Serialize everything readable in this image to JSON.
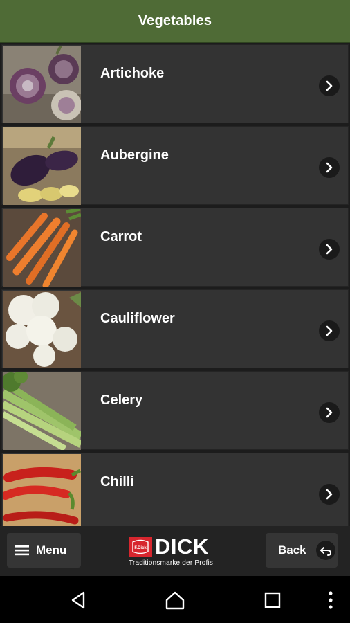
{
  "header": {
    "title": "Vegetables"
  },
  "items": [
    {
      "label": "Artichoke",
      "icon": "artichoke-image"
    },
    {
      "label": "Aubergine",
      "icon": "aubergine-image"
    },
    {
      "label": "Carrot",
      "icon": "carrot-image"
    },
    {
      "label": "Cauliflower",
      "icon": "cauliflower-image"
    },
    {
      "label": "Celery",
      "icon": "celery-image"
    },
    {
      "label": "Chilli",
      "icon": "chilli-image"
    }
  ],
  "footer": {
    "menu_label": "Menu",
    "back_label": "Back",
    "logo_word": "DICK",
    "logo_tagline": "Traditionsmarke der Profis",
    "logo_box_text": "F.Dick"
  },
  "colors": {
    "header_bg": "#4f6b36",
    "row_bg": "#333333",
    "brand_red": "#d7262e"
  },
  "system_nav": [
    "back-triangle-icon",
    "home-icon",
    "recents-square-icon",
    "overflow-dots-icon"
  ]
}
